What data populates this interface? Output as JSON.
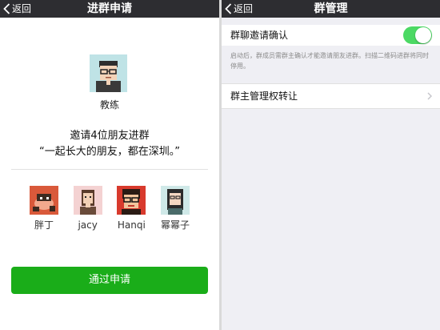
{
  "left": {
    "nav": {
      "back_label": "返回",
      "title": "进群申请"
    },
    "applicant": {
      "name": "教练"
    },
    "invite_text": "邀请4位朋友进群",
    "group_name": "“一起长大的朋友，都在深圳。”",
    "friends": [
      {
        "name": "胖丁"
      },
      {
        "name": "jacy"
      },
      {
        "name": "Hanqi"
      },
      {
        "name": "幂幂子"
      }
    ],
    "approve_label": "通过申请"
  },
  "right": {
    "nav": {
      "back_label": "返回",
      "title": "群管理"
    },
    "invite_confirm": {
      "label": "群聊邀请确认",
      "enabled": true
    },
    "hint": "启动后，群成员需群主确认才能邀请朋友进群。扫描二维码进群将同时停用。",
    "transfer_label": "群主管理权转让"
  },
  "colors": {
    "navbar": "#2d2d31",
    "accent_green": "#1aad19",
    "toggle_on": "#4cd964",
    "settings_bg": "#efeff4"
  }
}
